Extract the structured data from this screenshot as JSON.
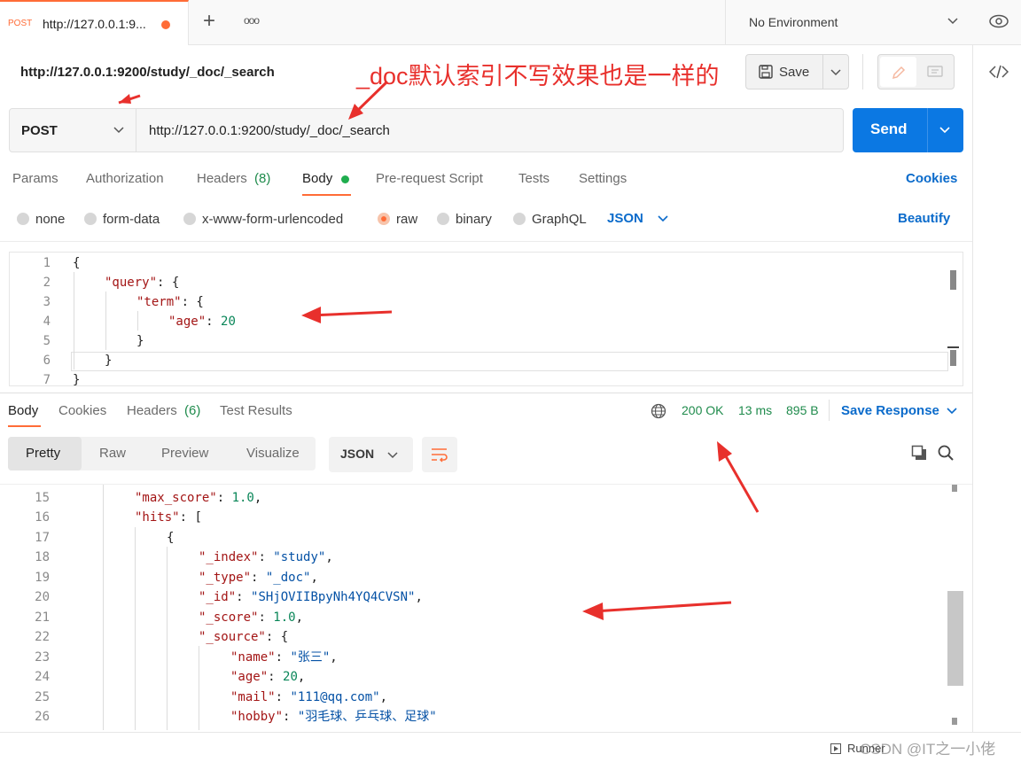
{
  "tab": {
    "method": "POST",
    "title": "http://127.0.0.1:9...",
    "new_tab": "+",
    "more": "ooo"
  },
  "env": {
    "label": "No Environment"
  },
  "header": {
    "url_title": "http://127.0.0.1:9200/study/_doc/_search",
    "save": "Save"
  },
  "annotation": {
    "note": "_doc默认索引不写效果也是一样的"
  },
  "request": {
    "method": "POST",
    "url": "http://127.0.0.1:9200/study/_doc/_search",
    "send": "Send"
  },
  "req_tabs": [
    {
      "label": "Params"
    },
    {
      "label": "Authorization"
    },
    {
      "label": "Headers",
      "count": "(8)"
    },
    {
      "label": "Body"
    },
    {
      "label": "Pre-request Script"
    },
    {
      "label": "Tests"
    },
    {
      "label": "Settings"
    }
  ],
  "cookies_link": "Cookies",
  "body_types": [
    "none",
    "form-data",
    "x-www-form-urlencoded",
    "raw",
    "binary",
    "GraphQL"
  ],
  "body_format": "JSON",
  "beautify": "Beautify",
  "request_body": [
    {
      "n": "1",
      "text": "{"
    },
    {
      "n": "2",
      "key": "\"query\"",
      "rest": ": {"
    },
    {
      "n": "3",
      "key": "\"term\"",
      "rest": ": {"
    },
    {
      "n": "4",
      "key": "\"age\"",
      "num": "20"
    },
    {
      "n": "5",
      "text": "}"
    },
    {
      "n": "6",
      "text": "}"
    },
    {
      "n": "7",
      "text": "}"
    }
  ],
  "resp_tabs": [
    {
      "label": "Body"
    },
    {
      "label": "Cookies"
    },
    {
      "label": "Headers",
      "count": "(6)"
    },
    {
      "label": "Test Results"
    }
  ],
  "resp_status": {
    "code": "200 OK",
    "time": "13 ms",
    "size": "895 B",
    "save": "Save Response"
  },
  "view_modes": [
    "Pretty",
    "Raw",
    "Preview",
    "Visualize"
  ],
  "resp_format": "JSON",
  "response_body": [
    {
      "n": "15",
      "key": "\"max_score\"",
      "val": "1.0",
      "type": "num",
      "tail": ","
    },
    {
      "n": "16",
      "key": "\"hits\"",
      "val": "[",
      "type": "punc",
      "tail": ""
    },
    {
      "n": "17",
      "key": "",
      "val": "{",
      "type": "punc",
      "tail": ""
    },
    {
      "n": "18",
      "key": "\"_index\"",
      "val": "\"study\"",
      "type": "str",
      "tail": ","
    },
    {
      "n": "19",
      "key": "\"_type\"",
      "val": "\"_doc\"",
      "type": "str",
      "tail": ","
    },
    {
      "n": "20",
      "key": "\"_id\"",
      "val": "\"SHjOVIIBpyNh4YQ4CVSN\"",
      "type": "str",
      "tail": ","
    },
    {
      "n": "21",
      "key": "\"_score\"",
      "val": "1.0",
      "type": "num",
      "tail": ","
    },
    {
      "n": "22",
      "key": "\"_source\"",
      "val": "{",
      "type": "punc",
      "tail": ""
    },
    {
      "n": "23",
      "key": "\"name\"",
      "val": "\"张三\"",
      "type": "str",
      "tail": ","
    },
    {
      "n": "24",
      "key": "\"age\"",
      "val": "20",
      "type": "num",
      "tail": ","
    },
    {
      "n": "25",
      "key": "\"mail\"",
      "val": "\"111@qq.com\"",
      "type": "str",
      "tail": ","
    },
    {
      "n": "26",
      "key": "\"hobby\"",
      "val": "\"羽毛球、乒乓球、足球\"",
      "type": "str",
      "tail": ""
    }
  ],
  "footer": {
    "runner": "Runner",
    "watermark": "CSDN @IT之一小佬"
  },
  "colors": {
    "accent": "#ff6c37",
    "send": "#0b78e3",
    "link": "#0b6bcb",
    "ok": "#1f8b4c",
    "arrow": "#e8302c"
  }
}
